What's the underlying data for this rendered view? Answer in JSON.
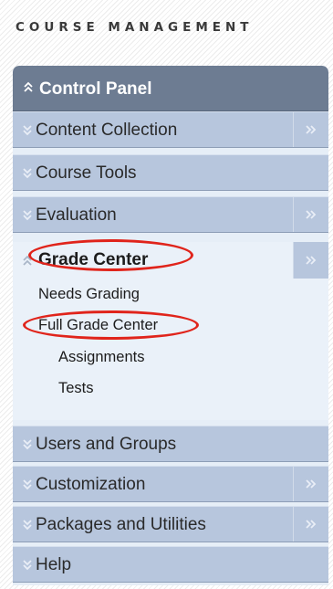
{
  "course_management": {
    "title": "COURSE MANAGEMENT"
  },
  "control_panel": {
    "title": "Control Panel",
    "items_before": [
      {
        "label": "Content Collection",
        "expandable": true
      },
      {
        "label": "Course Tools",
        "expandable": false
      },
      {
        "label": "Evaluation",
        "expandable": true
      }
    ],
    "grade_center": {
      "label": "Grade Center",
      "expanded": true,
      "children": [
        {
          "label": "Needs Grading",
          "highlighted": false
        },
        {
          "label": "Full Grade Center",
          "highlighted": true
        },
        {
          "label": "Assignments",
          "highlighted": false
        },
        {
          "label": "Tests",
          "highlighted": false
        }
      ]
    },
    "items_after": [
      {
        "label": "Users and Groups",
        "expandable": false
      },
      {
        "label": "Customization",
        "expandable": true
      },
      {
        "label": "Packages and Utilities",
        "expandable": true
      },
      {
        "label": "Help",
        "expandable": false
      }
    ]
  },
  "colors": {
    "header_bg": "#6d7c92",
    "row_bg": "#b7c6dd",
    "section_bg": "#eaf1f9",
    "highlight_oval": "#e0241b"
  }
}
